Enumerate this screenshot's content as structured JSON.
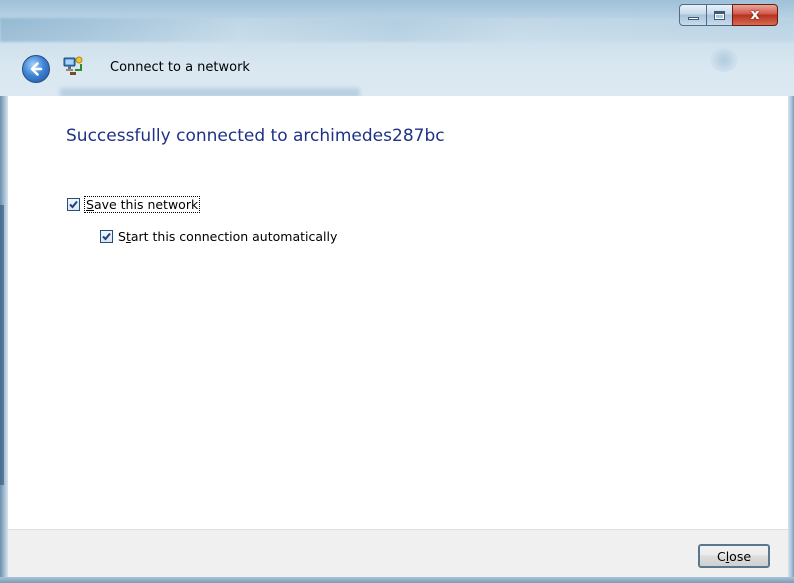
{
  "window": {
    "caption_buttons": {
      "minimize_icon": "minimize-icon",
      "maximize_icon": "maximize-icon",
      "close_glyph": "x"
    }
  },
  "header": {
    "back_icon": "back-arrow-icon",
    "app_icon": "network-icon",
    "title": "Connect to a network"
  },
  "main": {
    "headline": "Successfully connected to archimedes287bc",
    "options": [
      {
        "label_prefix": "",
        "label_access": "S",
        "label_rest": "ave this network",
        "checked": true
      },
      {
        "label_prefix": "S",
        "label_access": "t",
        "label_rest": "art this connection automatically",
        "checked": true
      }
    ]
  },
  "footer": {
    "close_prefix": "C",
    "close_access": "l",
    "close_rest": "ose"
  },
  "colors": {
    "headline": "#1e3287",
    "footer_bg": "#f0f0f0",
    "close_caption": "#c0392b"
  }
}
